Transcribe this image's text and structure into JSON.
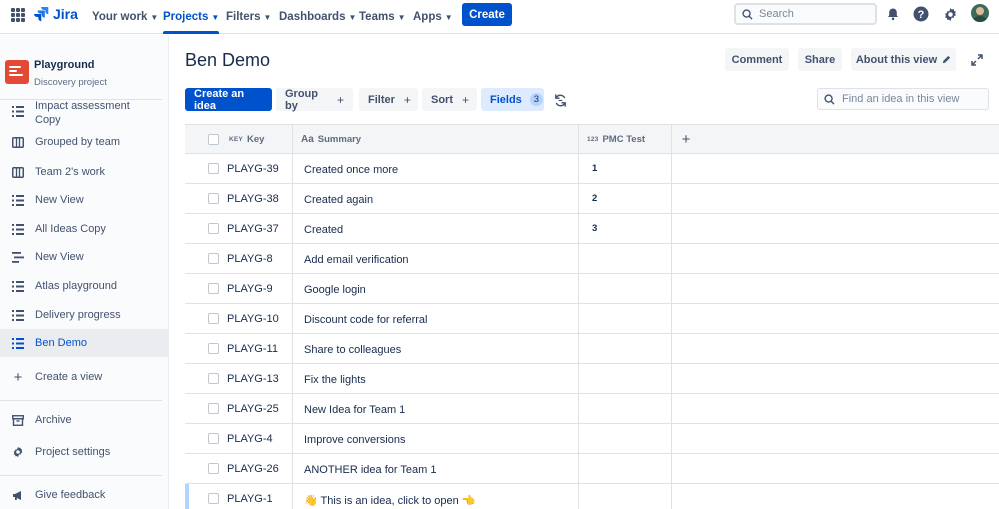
{
  "topnav": {
    "product": "Jira",
    "items": [
      {
        "label": "Your work",
        "active": false
      },
      {
        "label": "Projects",
        "active": true
      },
      {
        "label": "Filters",
        "active": false
      },
      {
        "label": "Dashboards",
        "active": false
      },
      {
        "label": "Teams",
        "active": false
      },
      {
        "label": "Apps",
        "active": false
      }
    ],
    "create_label": "Create",
    "search_placeholder": "Search",
    "icons": [
      "notifications-icon",
      "help-icon",
      "settings-icon"
    ]
  },
  "sidebar": {
    "project_name": "Playground",
    "project_type": "Discovery project",
    "views": [
      {
        "label": "Impact assessment",
        "label2": "Copy",
        "icon": "list-icon"
      },
      {
        "label": "Grouped by team",
        "icon": "board-icon"
      },
      {
        "label": "Team 2's work",
        "icon": "board-icon"
      },
      {
        "label": "New View",
        "icon": "list-icon"
      },
      {
        "label": "All Ideas Copy",
        "icon": "list-icon"
      },
      {
        "label": "New View",
        "icon": "timeline-icon"
      },
      {
        "label": "Atlas playground",
        "icon": "list-icon"
      },
      {
        "label": "Delivery progress",
        "icon": "list-icon"
      },
      {
        "label": "Ben Demo",
        "icon": "list-icon",
        "selected": true
      }
    ],
    "create_view": "Create a view",
    "archive": "Archive",
    "project_settings": "Project settings",
    "give_feedback": "Give feedback"
  },
  "header": {
    "title": "Ben Demo",
    "comment": "Comment",
    "share": "Share",
    "about": "About this view"
  },
  "toolbar": {
    "create_idea": "Create an idea",
    "group_by": "Group by",
    "filter": "Filter",
    "sort": "Sort",
    "fields": "Fields",
    "fields_count": "3",
    "find_placeholder": "Find an idea in this view"
  },
  "table": {
    "columns": {
      "key_tag": "KEY",
      "key": "Key",
      "summary_tag": "Aa",
      "summary": "Summary",
      "pmc_tag": "123",
      "pmc": "PMC Test"
    },
    "rows": [
      {
        "key": "PLAYG-39",
        "summary": "Created once more",
        "pmc": "1"
      },
      {
        "key": "PLAYG-38",
        "summary": "Created again",
        "pmc": "2"
      },
      {
        "key": "PLAYG-37",
        "summary": "Created",
        "pmc": "3"
      },
      {
        "key": "PLAYG-8",
        "summary": "Add email verification",
        "pmc": ""
      },
      {
        "key": "PLAYG-9",
        "summary": "Google login",
        "pmc": ""
      },
      {
        "key": "PLAYG-10",
        "summary": "Discount code for referral",
        "pmc": ""
      },
      {
        "key": "PLAYG-11",
        "summary": "Share to colleagues",
        "pmc": ""
      },
      {
        "key": "PLAYG-13",
        "summary": "Fix the lights",
        "pmc": ""
      },
      {
        "key": "PLAYG-25",
        "summary": "New Idea for Team 1",
        "pmc": ""
      },
      {
        "key": "PLAYG-4",
        "summary": "Improve conversions",
        "pmc": ""
      },
      {
        "key": "PLAYG-26",
        "summary": "ANOTHER idea for Team 1",
        "pmc": ""
      },
      {
        "key": "PLAYG-1",
        "summary": "👋 This is an idea, click to open 👈",
        "pmc": ""
      }
    ]
  }
}
